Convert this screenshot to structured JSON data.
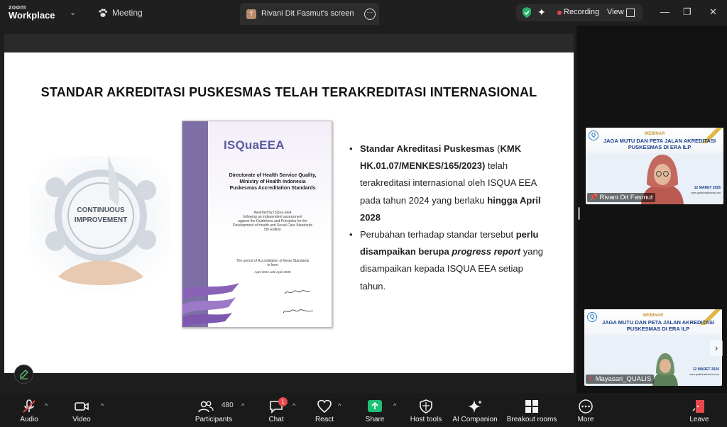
{
  "titlebar": {
    "brand_top": "zoom",
    "brand_bottom": "Workplace",
    "meeting_label": "Meeting",
    "share_tab_initial": "T",
    "share_tab_label": "Rivani Dit Fasmut's screen",
    "recording_label": "Recording",
    "view_label": "View"
  },
  "slide": {
    "title": "STANDAR AKREDITASI PUSKESMAS TELAH TERAKREDITASI INTERNASIONAL",
    "image_text": "CONTINUOUS\nIMPROVEMENT",
    "certificate": {
      "logo": "ISQuaEEA",
      "org": "Directorate of Health Service Quality,\nMinistry of Health Indonesia\nPuskesmas Accreditation Standards",
      "awarded": "Awarded by ISQua EEA\nfollowing an independent assessment\nagainst the Guidelines and Principles for the\nDevelopment of Health and Social Care Standards\n5th Edition",
      "period_label": "The period of Accreditation of these Standards\nis from",
      "period": "April 2024   until   April 2028"
    },
    "bullets": [
      {
        "parts": [
          {
            "text": "Standar Akreditasi Puskesmas",
            "style": "bold"
          },
          {
            "text": " (",
            "style": "normal"
          },
          {
            "text": "KMK HK.01.07/MENKES/165/2023)",
            "style": "bold"
          },
          {
            "text": " telah terakreditasi internasional oleh ISQUA EEA pada tahun 2024 yang berlaku ",
            "style": "normal"
          },
          {
            "text": "hingga April 2028",
            "style": "bold"
          }
        ]
      },
      {
        "parts": [
          {
            "text": "Perubahan terhadap standar tersebut ",
            "style": "normal"
          },
          {
            "text": "perlu disampaikan berupa ",
            "style": "bold"
          },
          {
            "text": "progress report",
            "style": "bolditalic"
          },
          {
            "text": " yang disampaikan kepada ISQUA EEA setiap tahun.",
            "style": "normal"
          }
        ]
      }
    ]
  },
  "participants": [
    {
      "name": "Rivani Dit Fasmut",
      "webinar_label": "WEBINAR",
      "heading": "JAGA MUTU DAN PETA JALAN AKREDITASI\nPUSKESMAS DI ERA ILP",
      "date": "12 MARET 2026",
      "url": "www.qualisinstitutions.com",
      "logo": "Q"
    },
    {
      "name": "Mayasari_QUALIS",
      "webinar_label": "WEBINAR",
      "heading": "JAGA MUTU DAN PETA JALAN AKREDITASI\nPUSKESMAS DI ERA ILP",
      "date": "12 MARET 2026",
      "url": "www.qualisinstitutions.com",
      "logo": "Q"
    }
  ],
  "toolbar": {
    "audio": "Audio",
    "video": "Video",
    "participants": "Participants",
    "participants_count": "480",
    "chat": "Chat",
    "chat_badge": "1",
    "react": "React",
    "share": "Share",
    "host_tools": "Host tools",
    "ai_companion": "AI Companion",
    "breakout_rooms": "Breakout rooms",
    "more": "More",
    "leave": "Leave"
  },
  "colors": {
    "leave": "#e5484d",
    "share": "#1dbf73",
    "recording": "#e5484d",
    "security": "#29b36b"
  }
}
